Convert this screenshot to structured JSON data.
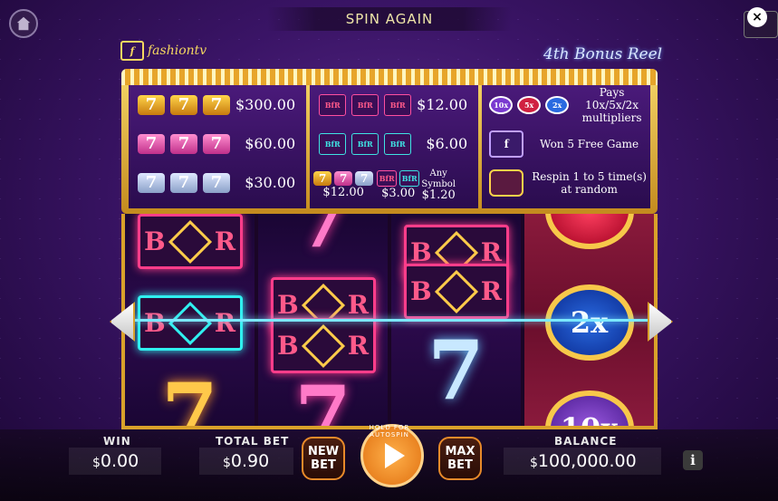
{
  "header": {
    "spin_again": "SPIN AGAIN",
    "close_label": "×"
  },
  "logo": {
    "text": "fashiontv",
    "icon_letter": "f"
  },
  "bonus_reel_title": "4th Bonus Reel",
  "paytable": {
    "sevens": [
      {
        "symbol": "gold-seven",
        "pay": "$300.00"
      },
      {
        "symbol": "pink-seven",
        "pay": "$60.00"
      },
      {
        "symbol": "silver-seven",
        "pay": "$30.00"
      }
    ],
    "bars": [
      {
        "symbol": "pink-bfr",
        "pay": "$12.00"
      },
      {
        "symbol": "cyan-bfr",
        "pay": "$6.00"
      }
    ],
    "any_combo": {
      "any_seven_pay": "$12.00",
      "any_bar_pay": "$3.00",
      "any_symbol_label": "Any Symbol",
      "any_symbol_pay": "$1.20"
    },
    "bonus": [
      {
        "icons": [
          "10x",
          "5x",
          "2x"
        ],
        "text": "Pays 10x/5x/2x multipliers"
      },
      {
        "icon": "free-games-icon",
        "text": "Won 5 Free Game"
      },
      {
        "icon": "respin-icon",
        "text": "Respin 1 to 5 time(s) at random"
      }
    ]
  },
  "reels": {
    "bfr_letters": [
      "B",
      "R"
    ],
    "seven_glyph": "7",
    "bonus_multipliers": [
      "2x",
      "10x"
    ]
  },
  "bottom_bar": {
    "win_label": "WIN",
    "win_currency": "$",
    "win_value": "0.00",
    "total_bet_label": "TOTAL BET",
    "total_bet_currency": "$",
    "total_bet_value": "0.90",
    "new_bet_label": "NEW BET",
    "hold_autospin": "HOLD FOR AUTOSPIN",
    "max_bet_label": "MAX BET",
    "balance_label": "BALANCE",
    "balance_currency": "$",
    "balance_value": "100,000.00",
    "info_label": "i"
  }
}
